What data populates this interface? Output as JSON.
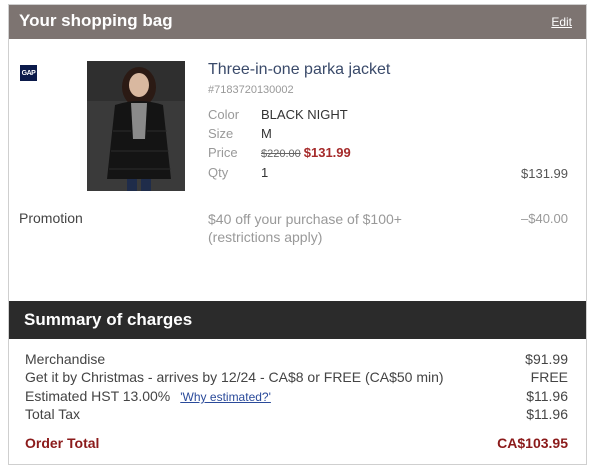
{
  "bag": {
    "title": "Your shopping bag",
    "edit_label": "Edit"
  },
  "brand": {
    "logo_text": "GAP"
  },
  "product": {
    "name": "Three-in-one parka jacket",
    "sku": "#7183720130002",
    "color_label": "Color",
    "color_value": "BLACK NIGHT",
    "size_label": "Size",
    "size_value": "M",
    "price_label": "Price",
    "price_original": "$220.00",
    "price_sale": "$131.99",
    "qty_label": "Qty",
    "qty_value": "1",
    "line_total": "$131.99",
    "image_icon": "parka-photo"
  },
  "promotion": {
    "label": "Promotion",
    "description": "$40 off your purchase of $100+ (restrictions apply)",
    "amount": "–$40.00"
  },
  "summary": {
    "title": "Summary of charges",
    "rows": [
      {
        "label": "Merchandise",
        "value": "$91.99"
      },
      {
        "label": "Get it by Christmas - arrives by 12/24 - CA$8 or FREE (CA$50 min)",
        "value": "FREE"
      },
      {
        "label": "Estimated HST 13.00%",
        "link": "'Why estimated?'",
        "value": "$11.96"
      },
      {
        "label": "Total Tax",
        "value": "$11.96"
      }
    ],
    "order_total_label": "Order Total",
    "order_total_value": "CA$103.95"
  },
  "colors": {
    "header_bg": "#7d7471",
    "summary_bg": "#2b2b2b",
    "accent_red": "#a52a2a",
    "logo_navy": "#0b1a4a"
  }
}
